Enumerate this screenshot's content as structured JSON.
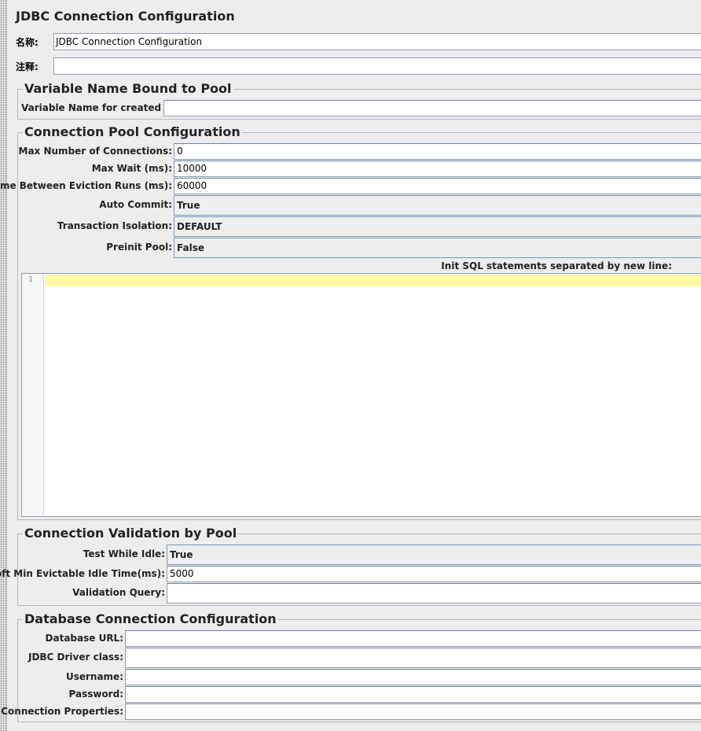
{
  "header": {
    "title": "JDBC Connection Configuration",
    "name_label": "名称:",
    "name_value": "JDBC Connection Configuration",
    "comment_label": "注释:",
    "comment_value": ""
  },
  "variable_group": {
    "title": "Variable Name Bound to Pool",
    "fields": [
      {
        "label": "Variable Name for created pool:",
        "value": ""
      }
    ]
  },
  "pool_group": {
    "title": "Connection Pool Configuration",
    "fields": [
      {
        "label": "Max Number of Connections:",
        "value": "0"
      },
      {
        "label": "Max Wait (ms):",
        "value": "10000"
      },
      {
        "label": "Time Between Eviction Runs (ms):",
        "value": "60000"
      },
      {
        "label": "Auto Commit:",
        "value": "True"
      },
      {
        "label": "Transaction Isolation:",
        "value": "DEFAULT"
      },
      {
        "label": "Preinit Pool:",
        "value": "False"
      }
    ],
    "init_sql_label": "Init SQL statements separated by new line:",
    "editor_line_number": "1"
  },
  "validation_group": {
    "title": "Connection Validation by Pool",
    "fields": [
      {
        "label": "Test While Idle:",
        "value": "True"
      },
      {
        "label": "Soft Min Evictable Idle Time(ms):",
        "value": "5000"
      },
      {
        "label": "Validation Query:",
        "value": ""
      }
    ]
  },
  "database_group": {
    "title": "Database Connection Configuration",
    "fields": [
      {
        "label": "Database URL:",
        "value": ""
      },
      {
        "label": "JDBC Driver class:",
        "value": ""
      },
      {
        "label": "Username:",
        "value": ""
      },
      {
        "label": "Password:",
        "value": ""
      },
      {
        "label": "Connection Properties:",
        "value": ""
      }
    ]
  },
  "colors": {
    "panel_bg": "#ededed",
    "field_border": "#8c9db4",
    "current_line_highlight": "#fffaa8"
  }
}
